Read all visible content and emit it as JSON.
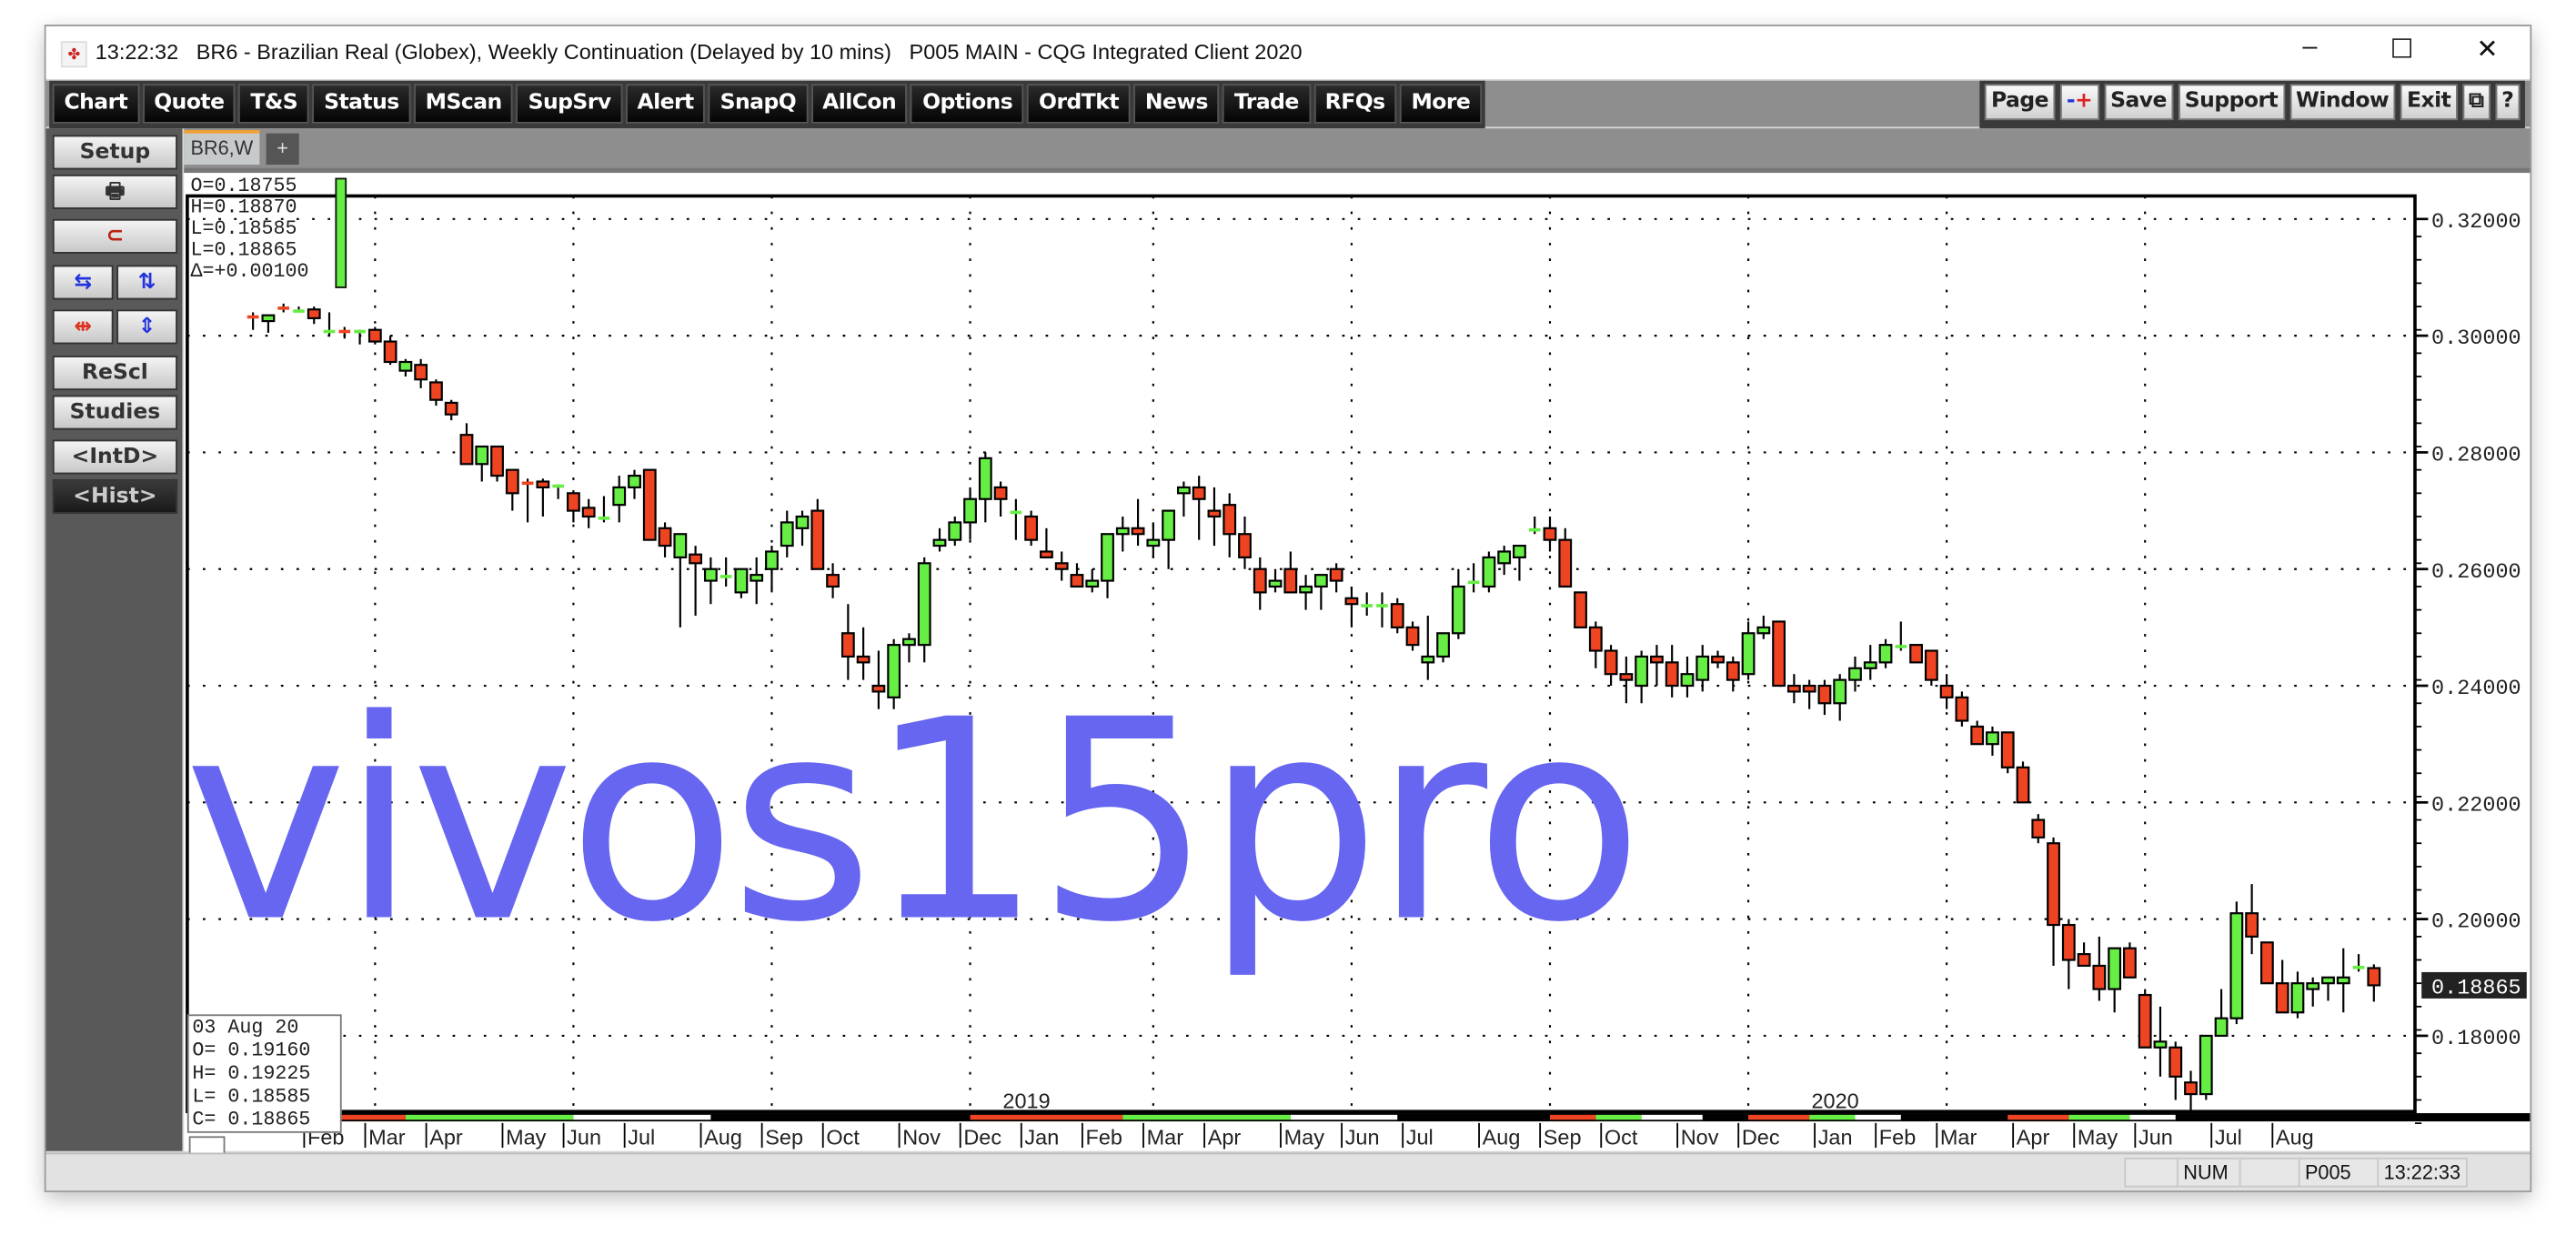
{
  "window": {
    "title": "13:22:32   BR6 - Brazilian Real (Globex), Weekly Continuation (Delayed by 10 mins)   P005 MAIN - CQG Integrated Client 2020",
    "minimize": "–",
    "maximize": "☐",
    "close": "✕"
  },
  "menu": {
    "left": [
      "Chart",
      "Quote",
      "T&S",
      "Status",
      "MScan",
      "SupSrv",
      "Alert",
      "SnapQ",
      "AllCon",
      "Options",
      "OrdTkt",
      "News",
      "Trade",
      "RFQs",
      "More"
    ],
    "right": [
      "Page",
      "-+",
      "Save",
      "Support",
      "Window",
      "Exit",
      "⧉",
      "?"
    ]
  },
  "sidebar": {
    "setup": "Setup",
    "print_icon": "🖶",
    "magnet_icon": "⊂",
    "rescl": "ReScl",
    "studies": "Studies",
    "intd": "<IntD>",
    "hist": "<Hist>"
  },
  "tabs": {
    "active": "BR6,W",
    "add": "+"
  },
  "quote_box": {
    "lines": [
      "O=0.18755",
      "H=0.18870",
      "L=0.18585",
      "L=0.18865",
      "Δ=+0.00100"
    ]
  },
  "cursor_box": {
    "date": "03 Aug 20",
    "open": "O=  0.19160",
    "high": "H=  0.19225",
    "low": "L=  0.18585",
    "close": "C=  0.18865"
  },
  "last_price_label": "0.18865",
  "status": {
    "num": "NUM",
    "page": "P005",
    "time": "13:22:33"
  },
  "watermark": "vivos15pro",
  "colors": {
    "up": "#66ee44",
    "down": "#ee4422",
    "watermark": "#6666f0"
  },
  "chart_data": {
    "type": "candlestick",
    "title": "BR6 - Brazilian Real (Globex), Weekly Continuation",
    "ylim": [
      0.165,
      0.32
    ],
    "yticks": [
      "0.32000",
      "0.30000",
      "0.28000",
      "0.26000",
      "0.24000",
      "0.22000",
      "0.20000",
      "0.18000"
    ],
    "ytick_values": [
      0.32,
      0.3,
      0.28,
      0.26,
      0.24,
      0.22,
      0.2,
      0.18
    ],
    "year_labels": [
      {
        "label": "2019",
        "week": 50
      },
      {
        "label": "2020",
        "week": 103
      }
    ],
    "month_labels": [
      {
        "label": "Feb",
        "week": 4
      },
      {
        "label": "Mar",
        "week": 8
      },
      {
        "label": "Apr",
        "week": 12
      },
      {
        "label": "May",
        "week": 17
      },
      {
        "label": "Jun",
        "week": 21
      },
      {
        "label": "Jul",
        "week": 25
      },
      {
        "label": "Aug",
        "week": 30
      },
      {
        "label": "Sep",
        "week": 34
      },
      {
        "label": "Oct",
        "week": 38
      },
      {
        "label": "Nov",
        "week": 43
      },
      {
        "label": "Dec",
        "week": 47
      },
      {
        "label": "Jan",
        "week": 51
      },
      {
        "label": "Feb",
        "week": 55
      },
      {
        "label": "Mar",
        "week": 59
      },
      {
        "label": "Apr",
        "week": 63
      },
      {
        "label": "May",
        "week": 68
      },
      {
        "label": "Jun",
        "week": 72
      },
      {
        "label": "Jul",
        "week": 76
      },
      {
        "label": "Aug",
        "week": 81
      },
      {
        "label": "Sep",
        "week": 85
      },
      {
        "label": "Oct",
        "week": 89
      },
      {
        "label": "Nov",
        "week": 94
      },
      {
        "label": "Dec",
        "week": 98
      },
      {
        "label": "Jan",
        "week": 103
      },
      {
        "label": "Feb",
        "week": 107
      },
      {
        "label": "Mar",
        "week": 111
      },
      {
        "label": "Apr",
        "week": 116
      },
      {
        "label": "May",
        "week": 120
      },
      {
        "label": "Jun",
        "week": 124
      },
      {
        "label": "Jul",
        "week": 129
      },
      {
        "label": "Aug",
        "week": 133
      }
    ],
    "ohlc": [
      [
        0.3035,
        0.304,
        0.301,
        0.303
      ],
      [
        0.3025,
        0.3035,
        0.3005,
        0.3035
      ],
      [
        0.305,
        0.3055,
        0.304,
        0.3045
      ],
      [
        0.3045,
        0.305,
        0.304,
        0.3045
      ],
      [
        0.3045,
        0.305,
        0.302,
        0.303
      ],
      [
        0.301,
        0.304,
        0.3,
        0.301
      ],
      [
        0.301,
        0.3015,
        0.2995,
        0.3005
      ],
      [
        0.3005,
        0.301,
        0.2985,
        0.301
      ],
      [
        0.301,
        0.3015,
        0.2985,
        0.299
      ],
      [
        0.299,
        0.3,
        0.295,
        0.2955
      ],
      [
        0.294,
        0.296,
        0.293,
        0.2955
      ],
      [
        0.295,
        0.296,
        0.291,
        0.2925
      ],
      [
        0.292,
        0.2925,
        0.288,
        0.289
      ],
      [
        0.2885,
        0.289,
        0.2855,
        0.2865
      ],
      [
        0.283,
        0.285,
        0.278,
        0.278
      ],
      [
        0.278,
        0.281,
        0.275,
        0.281
      ],
      [
        0.281,
        0.281,
        0.275,
        0.276
      ],
      [
        0.277,
        0.277,
        0.27,
        0.273
      ],
      [
        0.275,
        0.2755,
        0.268,
        0.2745
      ],
      [
        0.275,
        0.2755,
        0.269,
        0.274
      ],
      [
        0.2745,
        0.2745,
        0.272,
        0.2745
      ],
      [
        0.273,
        0.2735,
        0.268,
        0.27
      ],
      [
        0.2705,
        0.272,
        0.267,
        0.269
      ],
      [
        0.269,
        0.2725,
        0.268,
        0.269
      ],
      [
        0.271,
        0.276,
        0.268,
        0.274
      ],
      [
        0.274,
        0.277,
        0.272,
        0.276
      ],
      [
        0.277,
        0.277,
        0.265,
        0.265
      ],
      [
        0.267,
        0.268,
        0.262,
        0.264
      ],
      [
        0.262,
        0.265,
        0.25,
        0.266
      ],
      [
        0.2625,
        0.264,
        0.252,
        0.261
      ],
      [
        0.258,
        0.262,
        0.254,
        0.26
      ],
      [
        0.259,
        0.262,
        0.257,
        0.259
      ],
      [
        0.256,
        0.26,
        0.255,
        0.26
      ],
      [
        0.258,
        0.262,
        0.254,
        0.259
      ],
      [
        0.26,
        0.264,
        0.256,
        0.263
      ],
      [
        0.264,
        0.27,
        0.262,
        0.268
      ],
      [
        0.267,
        0.27,
        0.264,
        0.269
      ],
      [
        0.27,
        0.272,
        0.26,
        0.26
      ],
      [
        0.259,
        0.261,
        0.255,
        0.257
      ],
      [
        0.249,
        0.254,
        0.241,
        0.245
      ],
      [
        0.245,
        0.25,
        0.241,
        0.244
      ],
      [
        0.24,
        0.246,
        0.236,
        0.239
      ],
      [
        0.238,
        0.248,
        0.236,
        0.247
      ],
      [
        0.247,
        0.249,
        0.244,
        0.248
      ],
      [
        0.247,
        0.262,
        0.244,
        0.261
      ],
      [
        0.264,
        0.267,
        0.263,
        0.265
      ],
      [
        0.265,
        0.269,
        0.264,
        0.268
      ],
      [
        0.268,
        0.274,
        0.265,
        0.272
      ],
      [
        0.272,
        0.28,
        0.268,
        0.279
      ],
      [
        0.274,
        0.275,
        0.269,
        0.272
      ],
      [
        0.27,
        0.272,
        0.265,
        0.27
      ],
      [
        0.269,
        0.27,
        0.264,
        0.265
      ],
      [
        0.263,
        0.267,
        0.262,
        0.262
      ],
      [
        0.261,
        0.263,
        0.258,
        0.26
      ],
      [
        0.259,
        0.261,
        0.257,
        0.257
      ],
      [
        0.257,
        0.26,
        0.256,
        0.258
      ],
      [
        0.258,
        0.264,
        0.255,
        0.266
      ],
      [
        0.266,
        0.269,
        0.263,
        0.267
      ],
      [
        0.267,
        0.272,
        0.264,
        0.266
      ],
      [
        0.264,
        0.268,
        0.262,
        0.265
      ],
      [
        0.265,
        0.27,
        0.26,
        0.27
      ],
      [
        0.273,
        0.275,
        0.269,
        0.274
      ],
      [
        0.274,
        0.276,
        0.265,
        0.272
      ],
      [
        0.27,
        0.274,
        0.264,
        0.269
      ],
      [
        0.271,
        0.273,
        0.262,
        0.266
      ],
      [
        0.266,
        0.269,
        0.26,
        0.262
      ],
      [
        0.26,
        0.262,
        0.253,
        0.256
      ],
      [
        0.257,
        0.26,
        0.256,
        0.258
      ],
      [
        0.26,
        0.263,
        0.256,
        0.256
      ],
      [
        0.256,
        0.259,
        0.253,
        0.257
      ],
      [
        0.257,
        0.259,
        0.253,
        0.259
      ],
      [
        0.26,
        0.261,
        0.256,
        0.258
      ],
      [
        0.255,
        0.257,
        0.25,
        0.254
      ],
      [
        0.254,
        0.256,
        0.252,
        0.254
      ],
      [
        0.254,
        0.256,
        0.25,
        0.254
      ],
      [
        0.254,
        0.255,
        0.249,
        0.25
      ],
      [
        0.25,
        0.251,
        0.246,
        0.247
      ],
      [
        0.244,
        0.252,
        0.241,
        0.245
      ],
      [
        0.245,
        0.248,
        0.244,
        0.249
      ],
      [
        0.249,
        0.26,
        0.248,
        0.257
      ],
      [
        0.258,
        0.261,
        0.256,
        0.258
      ],
      [
        0.257,
        0.263,
        0.256,
        0.262
      ],
      [
        0.261,
        0.264,
        0.259,
        0.263
      ],
      [
        0.262,
        0.264,
        0.258,
        0.264
      ],
      [
        0.267,
        0.269,
        0.266,
        0.267
      ],
      [
        0.267,
        0.269,
        0.263,
        0.265
      ],
      [
        0.265,
        0.267,
        0.261,
        0.257
      ],
      [
        0.256,
        0.256,
        0.251,
        0.25
      ],
      [
        0.25,
        0.251,
        0.243,
        0.246
      ],
      [
        0.246,
        0.247,
        0.24,
        0.242
      ],
      [
        0.242,
        0.245,
        0.237,
        0.241
      ],
      [
        0.24,
        0.246,
        0.237,
        0.245
      ],
      [
        0.245,
        0.247,
        0.24,
        0.244
      ],
      [
        0.244,
        0.247,
        0.238,
        0.24
      ],
      [
        0.24,
        0.245,
        0.238,
        0.242
      ],
      [
        0.241,
        0.247,
        0.239,
        0.245
      ],
      [
        0.245,
        0.246,
        0.243,
        0.244
      ],
      [
        0.244,
        0.245,
        0.239,
        0.241
      ],
      [
        0.242,
        0.251,
        0.241,
        0.249
      ],
      [
        0.249,
        0.252,
        0.248,
        0.25
      ],
      [
        0.251,
        0.251,
        0.24,
        0.24
      ],
      [
        0.24,
        0.242,
        0.237,
        0.239
      ],
      [
        0.24,
        0.241,
        0.236,
        0.239
      ],
      [
        0.24,
        0.241,
        0.235,
        0.237
      ],
      [
        0.237,
        0.242,
        0.234,
        0.241
      ],
      [
        0.241,
        0.245,
        0.239,
        0.243
      ],
      [
        0.243,
        0.247,
        0.241,
        0.244
      ],
      [
        0.244,
        0.248,
        0.243,
        0.247
      ],
      [
        0.247,
        0.251,
        0.246,
        0.247
      ],
      [
        0.247,
        0.245,
        0.244,
        0.244
      ],
      [
        0.246,
        0.246,
        0.24,
        0.241
      ],
      [
        0.24,
        0.242,
        0.236,
        0.238
      ],
      [
        0.238,
        0.239,
        0.233,
        0.234
      ],
      [
        0.233,
        0.234,
        0.23,
        0.23
      ],
      [
        0.23,
        0.233,
        0.228,
        0.232
      ],
      [
        0.232,
        0.232,
        0.225,
        0.226
      ],
      [
        0.226,
        0.227,
        0.22,
        0.22
      ],
      [
        0.217,
        0.218,
        0.213,
        0.214
      ],
      [
        0.213,
        0.214,
        0.192,
        0.199
      ],
      [
        0.199,
        0.2,
        0.188,
        0.193
      ],
      [
        0.194,
        0.196,
        0.192,
        0.192
      ],
      [
        0.192,
        0.197,
        0.186,
        0.188
      ],
      [
        0.188,
        0.195,
        0.184,
        0.195
      ],
      [
        0.195,
        0.196,
        0.19,
        0.19
      ],
      [
        0.187,
        0.188,
        0.179,
        0.178
      ],
      [
        0.178,
        0.185,
        0.173,
        0.179
      ],
      [
        0.178,
        0.179,
        0.169,
        0.173
      ],
      [
        0.172,
        0.174,
        0.167,
        0.17
      ],
      [
        0.17,
        0.179,
        0.169,
        0.18
      ],
      [
        0.18,
        0.188,
        0.18,
        0.183
      ],
      [
        0.183,
        0.203,
        0.182,
        0.201
      ],
      [
        0.201,
        0.206,
        0.194,
        0.197
      ],
      [
        0.196,
        0.196,
        0.189,
        0.189
      ],
      [
        0.189,
        0.193,
        0.186,
        0.184
      ],
      [
        0.184,
        0.191,
        0.183,
        0.189
      ],
      [
        0.188,
        0.19,
        0.185,
        0.189
      ],
      [
        0.189,
        0.19,
        0.186,
        0.19
      ],
      [
        0.189,
        0.195,
        0.184,
        0.19
      ],
      [
        0.192,
        0.194,
        0.191,
        0.192
      ],
      [
        0.1916,
        0.19225,
        0.18585,
        0.18865
      ]
    ]
  }
}
